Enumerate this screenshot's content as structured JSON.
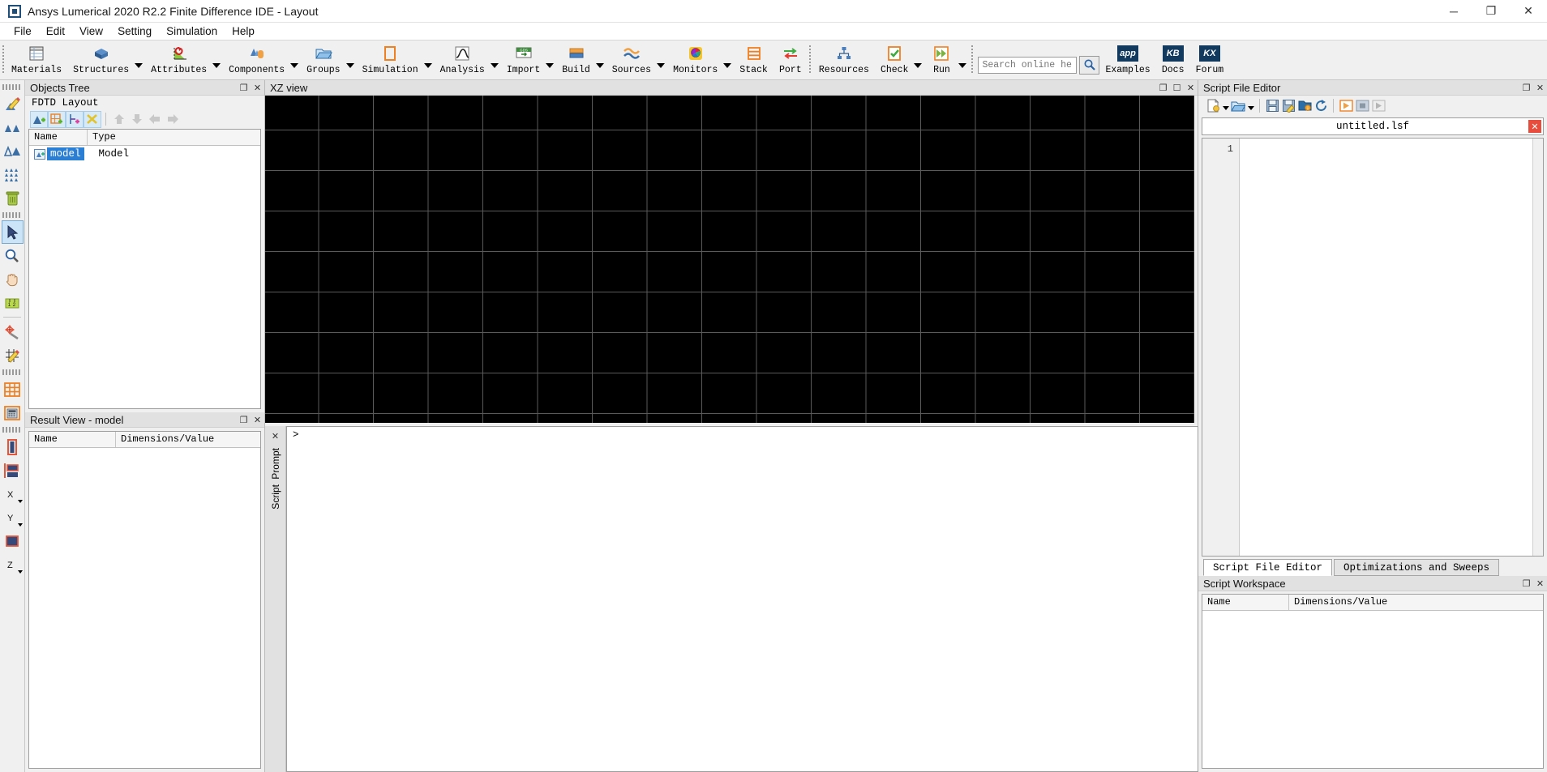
{
  "window": {
    "title": "Ansys Lumerical 2020 R2.2 Finite Difference IDE - Layout",
    "app_icon": "app-window-icon",
    "minimize": "─",
    "maximize": "❐",
    "close": "✕"
  },
  "menu": [
    {
      "label": "File"
    },
    {
      "label": "Edit"
    },
    {
      "label": "View"
    },
    {
      "label": "Setting"
    },
    {
      "label": "Simulation"
    },
    {
      "label": "Help"
    }
  ],
  "ribbon": {
    "groups": [
      {
        "buttons": [
          {
            "label": "Materials",
            "icon": "materials-table-icon",
            "has_dropdown": false
          },
          {
            "label": "Structures",
            "icon": "structures-cube-icon",
            "has_dropdown": true
          },
          {
            "label": "Attributes",
            "icon": "attributes-axis-icon",
            "has_dropdown": true
          },
          {
            "label": "Components",
            "icon": "components-objects-icon",
            "has_dropdown": true
          },
          {
            "label": "Groups",
            "icon": "groups-folder-icon",
            "has_dropdown": true
          },
          {
            "label": "Simulation",
            "icon": "simulation-region-icon",
            "has_dropdown": true
          },
          {
            "label": "Analysis",
            "icon": "analysis-curve-icon",
            "has_dropdown": true
          },
          {
            "label": "Import",
            "icon": "import-gds-icon",
            "has_dropdown": true
          },
          {
            "label": "Build",
            "icon": "build-layer-icon",
            "has_dropdown": true
          },
          {
            "label": "Sources",
            "icon": "sources-wave-icon",
            "has_dropdown": true
          },
          {
            "label": "Monitors",
            "icon": "monitors-sphere-icon",
            "has_dropdown": true
          },
          {
            "label": "Stack",
            "icon": "stack-layers-icon",
            "has_dropdown": false
          },
          {
            "label": "Port",
            "icon": "port-arrows-icon",
            "has_dropdown": false
          }
        ]
      },
      {
        "buttons": [
          {
            "label": "Resources",
            "icon": "resources-nodes-icon",
            "has_dropdown": false
          },
          {
            "label": "Check",
            "icon": "check-clipboard-icon",
            "has_dropdown": true
          },
          {
            "label": "Run",
            "icon": "run-forward-icon",
            "has_dropdown": true
          }
        ]
      }
    ],
    "search": {
      "placeholder": "Search online help",
      "value": "",
      "icon": "search-magnifier-icon"
    },
    "help_links": [
      {
        "label": "Examples",
        "badge": "app"
      },
      {
        "label": "Docs",
        "badge": "KB"
      },
      {
        "label": "Forum",
        "badge": "KX"
      }
    ]
  },
  "left_toolbar": {
    "items": [
      {
        "name": "edit-object-icon",
        "active": false
      },
      {
        "name": "group-objects-icon",
        "active": false
      },
      {
        "name": "ungroup-objects-icon",
        "active": false
      },
      {
        "name": "array-objects-icon",
        "active": false
      },
      {
        "name": "delete-object-icon",
        "active": false
      },
      {
        "name": "select-tool-icon",
        "active": true
      },
      {
        "name": "zoom-tool-icon",
        "active": false
      },
      {
        "name": "pan-tool-icon",
        "active": false
      },
      {
        "name": "measure-tool-icon",
        "active": false
      },
      {
        "name": "move-tool-icon",
        "active": false
      },
      {
        "name": "edit-mesh-icon",
        "active": false
      },
      {
        "name": "view-mesh-icon",
        "active": false
      },
      {
        "name": "mesh-calculator-icon",
        "active": false
      },
      {
        "name": "view-perspective-icon",
        "active": false
      },
      {
        "name": "view-xy-icon",
        "active": false
      },
      {
        "name": "view-x-icon",
        "active": false
      },
      {
        "name": "view-y-icon",
        "active": false
      },
      {
        "name": "view-z-icon",
        "active": false
      }
    ],
    "axis_labels": [
      "X",
      "Y",
      "Z"
    ]
  },
  "objects_tree": {
    "title": "Objects Tree",
    "undock_icon": "undock-icon",
    "close_icon": "close-icon",
    "layout_label": "FDTD Layout",
    "toolbar": [
      {
        "name": "add-structure-icon",
        "group": true
      },
      {
        "name": "add-mesh-icon",
        "group": true
      },
      {
        "name": "add-monitor-icon",
        "group": true
      },
      {
        "name": "add-source-icon",
        "group": true
      },
      {
        "name": "move-up-icon",
        "group": false
      },
      {
        "name": "move-down-icon",
        "group": false
      },
      {
        "name": "move-left-icon",
        "group": false
      },
      {
        "name": "move-right-icon",
        "group": false
      }
    ],
    "columns": [
      "Name",
      "Type"
    ],
    "rows": [
      {
        "name": "model",
        "type": "Model",
        "selected": true,
        "icon": "model-node-icon"
      }
    ]
  },
  "result_view": {
    "title": "Result View - model",
    "undock_icon": "undock-icon",
    "close_icon": "close-icon",
    "columns": [
      "Name",
      "Dimensions/Value"
    ],
    "rows": []
  },
  "xz_view": {
    "title": "XZ view",
    "undock_icon": "undock-icon",
    "restore_icon": "restore-icon",
    "close_icon": "close-icon",
    "background": "#000000",
    "grid_color": "#5a5a5a"
  },
  "script_editor": {
    "title": "Script File Editor",
    "undock_icon": "undock-icon",
    "close_icon": "close-icon",
    "toolbar": [
      {
        "name": "new-script-icon",
        "has_dropdown": true
      },
      {
        "name": "open-script-icon",
        "has_dropdown": true
      },
      {
        "name": "save-script-icon",
        "has_dropdown": false
      },
      {
        "name": "save-as-script-icon",
        "has_dropdown": false
      },
      {
        "name": "open-folder-icon",
        "has_dropdown": false
      },
      {
        "name": "reload-script-icon",
        "has_dropdown": false
      },
      {
        "name": "run-script-icon",
        "has_dropdown": false
      },
      {
        "name": "stop-script-icon",
        "has_dropdown": false
      },
      {
        "name": "step-script-icon",
        "has_dropdown": false
      }
    ],
    "open_file": {
      "name": "untitled.lsf",
      "close_icon": "close-tab-icon"
    },
    "line_numbers": [
      "1"
    ],
    "content": "",
    "tabs": [
      {
        "label": "Script File Editor",
        "active": true
      },
      {
        "label": "Optimizations and Sweeps",
        "active": false
      }
    ]
  },
  "prompt": {
    "vertical_tabs": [
      "Prompt",
      "Script"
    ],
    "close_icon": "close-icon",
    "caret": ">",
    "value": ""
  },
  "script_workspace": {
    "title": "Script Workspace",
    "undock_icon": "undock-icon",
    "close_icon": "close-icon",
    "columns": [
      "Name",
      "Dimensions/Value"
    ],
    "rows": []
  }
}
